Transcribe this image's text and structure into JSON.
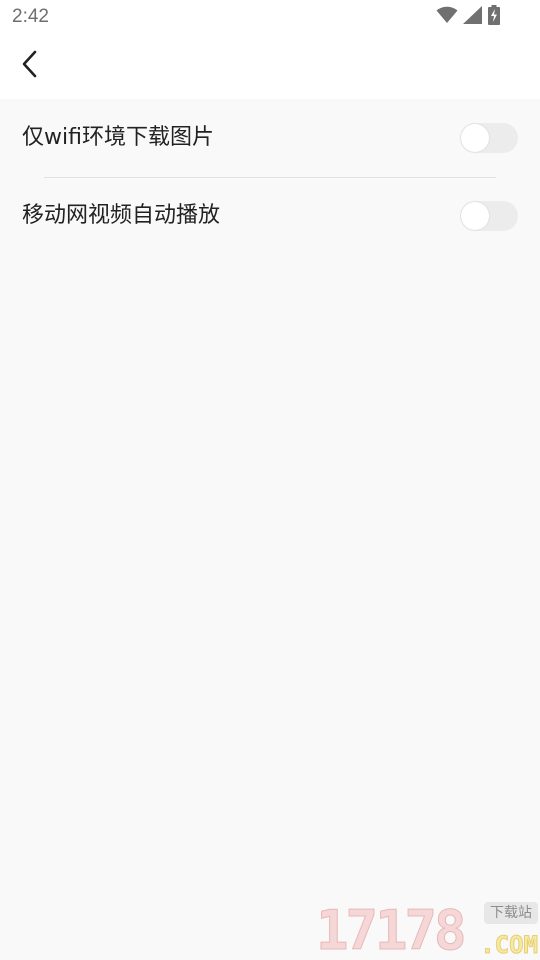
{
  "status_bar": {
    "time": "2:42",
    "icons": [
      "wifi-icon",
      "cellular-signal-icon",
      "battery-charging-icon"
    ]
  },
  "app_bar": {
    "back_icon": "chevron-left-icon"
  },
  "settings": [
    {
      "label": "仅wifi环境下载图片",
      "enabled": false
    },
    {
      "label": "移动网视频自动播放",
      "enabled": false
    }
  ],
  "watermark": {
    "number": "17178",
    "badge": "下载站",
    "domain": ".COM"
  },
  "colors": {
    "background": "#f9f9f9",
    "bar_background": "#ffffff",
    "text": "#222222",
    "toggle_track_off": "#ececec",
    "toggle_knob": "#ffffff",
    "divider": "#e2e2e2"
  }
}
